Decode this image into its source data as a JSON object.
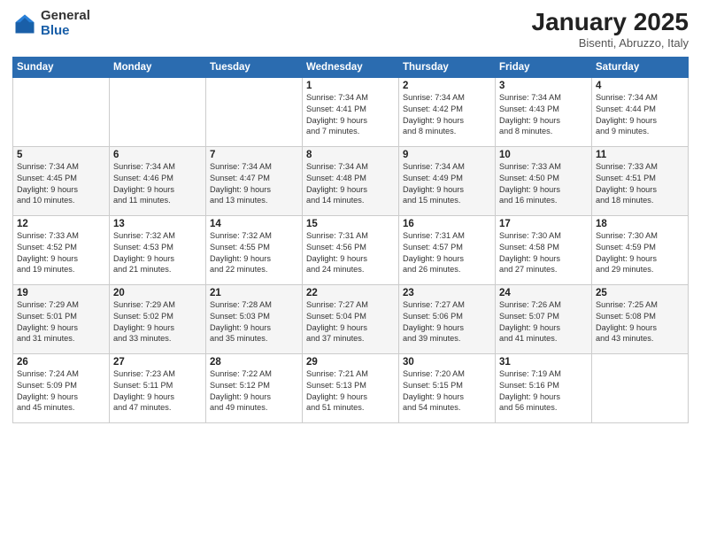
{
  "logo": {
    "general": "General",
    "blue": "Blue"
  },
  "header": {
    "month": "January 2025",
    "location": "Bisenti, Abruzzo, Italy"
  },
  "days_of_week": [
    "Sunday",
    "Monday",
    "Tuesday",
    "Wednesday",
    "Thursday",
    "Friday",
    "Saturday"
  ],
  "weeks": [
    [
      {
        "num": "",
        "info": ""
      },
      {
        "num": "",
        "info": ""
      },
      {
        "num": "",
        "info": ""
      },
      {
        "num": "1",
        "info": "Sunrise: 7:34 AM\nSunset: 4:41 PM\nDaylight: 9 hours\nand 7 minutes."
      },
      {
        "num": "2",
        "info": "Sunrise: 7:34 AM\nSunset: 4:42 PM\nDaylight: 9 hours\nand 8 minutes."
      },
      {
        "num": "3",
        "info": "Sunrise: 7:34 AM\nSunset: 4:43 PM\nDaylight: 9 hours\nand 8 minutes."
      },
      {
        "num": "4",
        "info": "Sunrise: 7:34 AM\nSunset: 4:44 PM\nDaylight: 9 hours\nand 9 minutes."
      }
    ],
    [
      {
        "num": "5",
        "info": "Sunrise: 7:34 AM\nSunset: 4:45 PM\nDaylight: 9 hours\nand 10 minutes."
      },
      {
        "num": "6",
        "info": "Sunrise: 7:34 AM\nSunset: 4:46 PM\nDaylight: 9 hours\nand 11 minutes."
      },
      {
        "num": "7",
        "info": "Sunrise: 7:34 AM\nSunset: 4:47 PM\nDaylight: 9 hours\nand 13 minutes."
      },
      {
        "num": "8",
        "info": "Sunrise: 7:34 AM\nSunset: 4:48 PM\nDaylight: 9 hours\nand 14 minutes."
      },
      {
        "num": "9",
        "info": "Sunrise: 7:34 AM\nSunset: 4:49 PM\nDaylight: 9 hours\nand 15 minutes."
      },
      {
        "num": "10",
        "info": "Sunrise: 7:33 AM\nSunset: 4:50 PM\nDaylight: 9 hours\nand 16 minutes."
      },
      {
        "num": "11",
        "info": "Sunrise: 7:33 AM\nSunset: 4:51 PM\nDaylight: 9 hours\nand 18 minutes."
      }
    ],
    [
      {
        "num": "12",
        "info": "Sunrise: 7:33 AM\nSunset: 4:52 PM\nDaylight: 9 hours\nand 19 minutes."
      },
      {
        "num": "13",
        "info": "Sunrise: 7:32 AM\nSunset: 4:53 PM\nDaylight: 9 hours\nand 21 minutes."
      },
      {
        "num": "14",
        "info": "Sunrise: 7:32 AM\nSunset: 4:55 PM\nDaylight: 9 hours\nand 22 minutes."
      },
      {
        "num": "15",
        "info": "Sunrise: 7:31 AM\nSunset: 4:56 PM\nDaylight: 9 hours\nand 24 minutes."
      },
      {
        "num": "16",
        "info": "Sunrise: 7:31 AM\nSunset: 4:57 PM\nDaylight: 9 hours\nand 26 minutes."
      },
      {
        "num": "17",
        "info": "Sunrise: 7:30 AM\nSunset: 4:58 PM\nDaylight: 9 hours\nand 27 minutes."
      },
      {
        "num": "18",
        "info": "Sunrise: 7:30 AM\nSunset: 4:59 PM\nDaylight: 9 hours\nand 29 minutes."
      }
    ],
    [
      {
        "num": "19",
        "info": "Sunrise: 7:29 AM\nSunset: 5:01 PM\nDaylight: 9 hours\nand 31 minutes."
      },
      {
        "num": "20",
        "info": "Sunrise: 7:29 AM\nSunset: 5:02 PM\nDaylight: 9 hours\nand 33 minutes."
      },
      {
        "num": "21",
        "info": "Sunrise: 7:28 AM\nSunset: 5:03 PM\nDaylight: 9 hours\nand 35 minutes."
      },
      {
        "num": "22",
        "info": "Sunrise: 7:27 AM\nSunset: 5:04 PM\nDaylight: 9 hours\nand 37 minutes."
      },
      {
        "num": "23",
        "info": "Sunrise: 7:27 AM\nSunset: 5:06 PM\nDaylight: 9 hours\nand 39 minutes."
      },
      {
        "num": "24",
        "info": "Sunrise: 7:26 AM\nSunset: 5:07 PM\nDaylight: 9 hours\nand 41 minutes."
      },
      {
        "num": "25",
        "info": "Sunrise: 7:25 AM\nSunset: 5:08 PM\nDaylight: 9 hours\nand 43 minutes."
      }
    ],
    [
      {
        "num": "26",
        "info": "Sunrise: 7:24 AM\nSunset: 5:09 PM\nDaylight: 9 hours\nand 45 minutes."
      },
      {
        "num": "27",
        "info": "Sunrise: 7:23 AM\nSunset: 5:11 PM\nDaylight: 9 hours\nand 47 minutes."
      },
      {
        "num": "28",
        "info": "Sunrise: 7:22 AM\nSunset: 5:12 PM\nDaylight: 9 hours\nand 49 minutes."
      },
      {
        "num": "29",
        "info": "Sunrise: 7:21 AM\nSunset: 5:13 PM\nDaylight: 9 hours\nand 51 minutes."
      },
      {
        "num": "30",
        "info": "Sunrise: 7:20 AM\nSunset: 5:15 PM\nDaylight: 9 hours\nand 54 minutes."
      },
      {
        "num": "31",
        "info": "Sunrise: 7:19 AM\nSunset: 5:16 PM\nDaylight: 9 hours\nand 56 minutes."
      },
      {
        "num": "",
        "info": ""
      }
    ]
  ]
}
